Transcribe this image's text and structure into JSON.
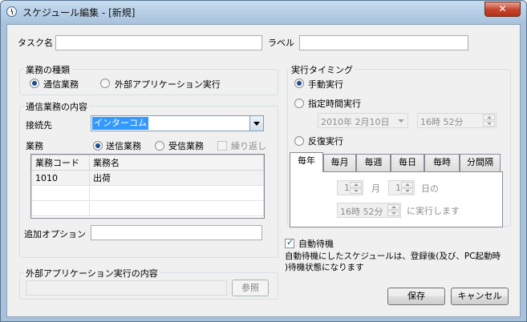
{
  "window": {
    "title": "スケジュール編集 - [新規]"
  },
  "top": {
    "task_name_label": "タスク名",
    "task_name_value": "",
    "label_label": "ラベル",
    "label_value": ""
  },
  "work_type": {
    "title": "業務の種類",
    "options": [
      {
        "label": "通信業務",
        "selected": true
      },
      {
        "label": "外部アプリケーション実行",
        "selected": false
      }
    ]
  },
  "comm": {
    "title": "通信業務の内容",
    "connection_label": "接続先",
    "connection_value": "インターコム",
    "task_label": "業務",
    "send_label": "送信業務",
    "receive_label": "受信業務",
    "repeat_label": "繰り返し",
    "table": {
      "headers": [
        "業務コード",
        "業務名"
      ],
      "rows": [
        [
          "1010",
          "出荷"
        ],
        [
          "",
          ""
        ],
        [
          "",
          ""
        ]
      ]
    },
    "option_label": "追加オプション",
    "option_value": ""
  },
  "ext": {
    "title": "外部アプリケーション実行の内容",
    "path_value": "",
    "browse_label": "参照"
  },
  "timing": {
    "title": "実行タイミング",
    "manual_label": "手動実行",
    "scheduled_label": "指定時間実行",
    "date_value": "2010年  2月10日",
    "time_value": "16時 52分",
    "repeat_label": "反復実行",
    "tabs": [
      "毎年",
      "毎月",
      "毎週",
      "毎日",
      "毎時",
      "分間隔"
    ],
    "month_value": "1",
    "month_unit": "月",
    "day_value": "1",
    "day_unit": "日の",
    "repeat_time_value": "16時 52分",
    "repeat_suffix": "に実行します"
  },
  "auto": {
    "checkbox_label": "自動待機",
    "note_line1": "自動待機にしたスケジュールは、登録後(及び、PC起動時",
    "note_line2": ")待機状態になります"
  },
  "buttons": {
    "save": "保存",
    "cancel": "キャンセル"
  },
  "colors": {
    "selection": "#3399ff",
    "close": "#c4422a"
  }
}
